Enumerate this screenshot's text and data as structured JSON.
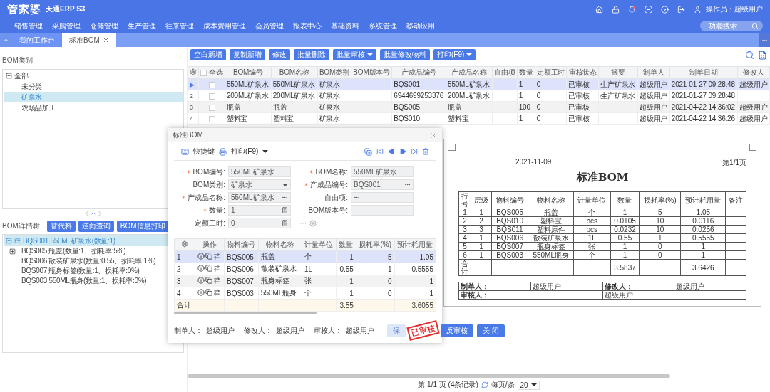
{
  "header": {
    "logo": "管家婆",
    "product": "天通ERP S3",
    "operator": "操作员：超级用户",
    "search": {
      "placeholder": "功能搜索"
    },
    "nav": [
      "销售管理",
      "采购管理",
      "仓储管理",
      "生产管理",
      "往来管理",
      "成本费用管理",
      "会员管理",
      "报表中心",
      "基础资料",
      "系统管理",
      "移动应用"
    ]
  },
  "tabs": [
    {
      "label": "我的工作台",
      "selected": false,
      "closable": false
    },
    {
      "label": "标准BOM",
      "selected": true,
      "closable": true
    }
  ],
  "left": {
    "category_title": "BOM类别",
    "categories": [
      {
        "label": "全部",
        "selected": false,
        "expanded": true,
        "children": [
          {
            "label": "未分类",
            "selected": false
          },
          {
            "label": "矿泉水",
            "selected": true
          },
          {
            "label": "农场品加工",
            "selected": false
          }
        ]
      }
    ],
    "detail_title": "BOM详情树",
    "detail_buttons": [
      {
        "label": "替代料",
        "dropdown": false
      },
      {
        "label": "逆向查询",
        "dropdown": false
      },
      {
        "label": "BOM信息打印",
        "dropdown": true
      }
    ],
    "detail_tree": [
      {
        "label": "BQS001 550ML矿泉水(数量:1)",
        "selected": true,
        "expanded": true,
        "children": [
          {
            "label": "BQS005 瓶盖(数量:1、损耗率:5%)",
            "selected": false,
            "has_children": true
          },
          {
            "label": "BQS006 散装矿泉水(数量:0.55、损耗率:1%)",
            "selected": false,
            "has_children": false
          },
          {
            "label": "BQS007 瓶身标签(数量:1、损耗率:0%)",
            "selected": false,
            "has_children": false
          },
          {
            "label": "BQS003 550ML瓶身(数量:1、损耗率:0%)",
            "selected": false,
            "has_children": false
          }
        ]
      }
    ]
  },
  "toolbar": [
    {
      "label": "空白新增",
      "dropdown": false
    },
    {
      "label": "复制新增",
      "dropdown": false
    },
    {
      "label": "修改",
      "dropdown": false
    },
    {
      "label": "批量删除",
      "dropdown": false
    },
    {
      "label": "批量审核",
      "dropdown": true
    },
    {
      "label": "批量修改物料",
      "dropdown": false
    },
    {
      "label": "打印(F9)",
      "dropdown": true
    }
  ],
  "grid": {
    "select_all": {
      "label": "全选",
      "checked": false
    },
    "columns": [
      "BOM编号",
      "BOM名称",
      "BOM类别",
      "BOM版本号",
      "产成品编号",
      "产成品名称",
      "自由项",
      "数量",
      "定额工时",
      "审核状态",
      "摘要",
      "制单人",
      "制单日期",
      "修改人"
    ],
    "rows": [
      {
        "no": "▶",
        "selected": true,
        "checked": false,
        "cells": [
          "550ML矿泉水",
          "550ML矿泉水",
          "矿泉水",
          "",
          "BQS001",
          "550ML矿泉水",
          "",
          "1",
          "0",
          "已审核",
          "生产矿泉水",
          "超级用户",
          "2021-01-27 09:28:48",
          "超级用户"
        ]
      },
      {
        "no": "2",
        "selected": false,
        "checked": false,
        "cells": [
          "200ML矿泉水",
          "200ML矿泉水",
          "矿泉水",
          "",
          "6944699253376",
          "200ML矿泉水",
          "",
          "1",
          "0",
          "已审核",
          "生产矿泉水",
          "超级用户",
          "2021-01-27 09:28:48",
          ""
        ]
      },
      {
        "no": "3",
        "selected": false,
        "checked": false,
        "cells": [
          "瓶盖",
          "瓶盖",
          "矿泉水",
          "",
          "BQS005",
          "瓶盖",
          "",
          "100",
          "0",
          "已审核",
          "",
          "超级用户",
          "2021-04-22 14:36:02",
          "超级用户"
        ]
      },
      {
        "no": "4",
        "selected": false,
        "checked": false,
        "cells": [
          "塑料宝",
          "塑料宝",
          "矿泉水",
          "",
          "BQS010",
          "塑料宝",
          "",
          "1",
          "0",
          "已审核",
          "",
          "超级用户",
          "2021-04-22 14:36:26",
          "超级用户"
        ]
      }
    ]
  },
  "preview": {
    "date": "2021-11-09",
    "page": "第1/1页",
    "title": "标准BOM",
    "columns": [
      "行号",
      "层级",
      "物料编号",
      "物料名称",
      "计量单位",
      "数量",
      "损耗率(%)",
      "预计耗用量",
      "备注"
    ],
    "rows": [
      [
        "1",
        "1",
        "BQS005",
        "瓶盖",
        "个",
        "1",
        "5",
        "1.05"
      ],
      [
        "2",
        "2",
        "BQS010",
        "塑料宝",
        "pcs",
        "0.0105",
        "10",
        "0.0116"
      ],
      [
        "3",
        "3",
        "BQS011",
        "塑料原件",
        "pcs",
        "0.0232",
        "10",
        "0.0256"
      ],
      [
        "4",
        "1",
        "BQS006",
        "散装矿泉水",
        "1L",
        "0.55",
        "1",
        "0.5555"
      ],
      [
        "5",
        "1",
        "BQS007",
        "瓶身标签",
        "张",
        "1",
        "0",
        "1"
      ],
      [
        "6",
        "1",
        "BQS003",
        "550ML瓶身",
        "个",
        "1",
        "0",
        "1"
      ]
    ],
    "total": {
      "label": "合计",
      "qty": "3.5837",
      "est": "3.6426"
    },
    "signatures": [
      {
        "label": "制单人：",
        "value": "超级用户"
      },
      {
        "label": "修改人：",
        "value": "超级用户"
      },
      {
        "label": "审核人：",
        "value": "超级用户"
      }
    ]
  },
  "pager": {
    "info": "第 1/1 页 (4条记录)",
    "per_page_label": "每页/条",
    "per_page": "20"
  },
  "dialog": {
    "title": "标准BOM",
    "shortcut": "快捷键",
    "print": "打印(F9)",
    "fields": [
      {
        "label": "BOM编号:",
        "required": true,
        "value": "550ML矿泉水",
        "kind": "text"
      },
      {
        "label": "BOM名称:",
        "required": true,
        "value": "550ML矿泉水",
        "kind": "text"
      },
      {
        "label": "BOM类别:",
        "required": false,
        "value": "矿泉水",
        "kind": "select"
      },
      {
        "label": "产成品编号:",
        "required": true,
        "value": "BQS001",
        "kind": "lookup"
      },
      {
        "label": "产成品名称:",
        "required": true,
        "value": "550ML矿泉水",
        "kind": "lookup"
      },
      {
        "label": "自由项:",
        "required": false,
        "kind": "lookup"
      },
      {
        "label": "数量:",
        "required": true,
        "value": "1",
        "kind": "number"
      },
      {
        "label": "BOM版本号:",
        "required": false,
        "kind": "text"
      },
      {
        "label": "定额工时:",
        "required": false,
        "value": "0",
        "kind": "number"
      }
    ],
    "more": "···",
    "ops_label": "操作",
    "columns": [
      "物料编号",
      "物料名称",
      "计量单位",
      "数量",
      "损耗率(%)",
      "预计耗用量"
    ],
    "rows": [
      {
        "no": "1",
        "selected": true,
        "cells": [
          "BQS005",
          "瓶盖",
          "个",
          "1",
          "5",
          "1.05"
        ]
      },
      {
        "no": "2",
        "selected": false,
        "cells": [
          "BQS006",
          "散装矿泉水",
          "1L",
          "0.55",
          "1",
          "0.5555"
        ]
      },
      {
        "no": "3",
        "selected": false,
        "cells": [
          "BQS007",
          "瓶身标签",
          "张",
          "1",
          "0",
          "1"
        ]
      },
      {
        "no": "4",
        "selected": false,
        "cells": [
          "BQS003",
          "550ML瓶身",
          "个",
          "1",
          "0",
          "1"
        ]
      }
    ],
    "total": {
      "label": "合计",
      "qty": "3.55",
      "est": "3.6055"
    },
    "people": [
      {
        "label": "制单人：",
        "value": "超级用户"
      },
      {
        "label": "修改人：",
        "value": "超级用户"
      },
      {
        "label": "审核人：",
        "value": "超级用户"
      }
    ],
    "stamp": "已审核",
    "buttons": [
      {
        "label": "保",
        "disabled": true
      },
      {
        "label": "反审核",
        "disabled": false
      },
      {
        "label": "关 闭",
        "disabled": false
      }
    ]
  }
}
